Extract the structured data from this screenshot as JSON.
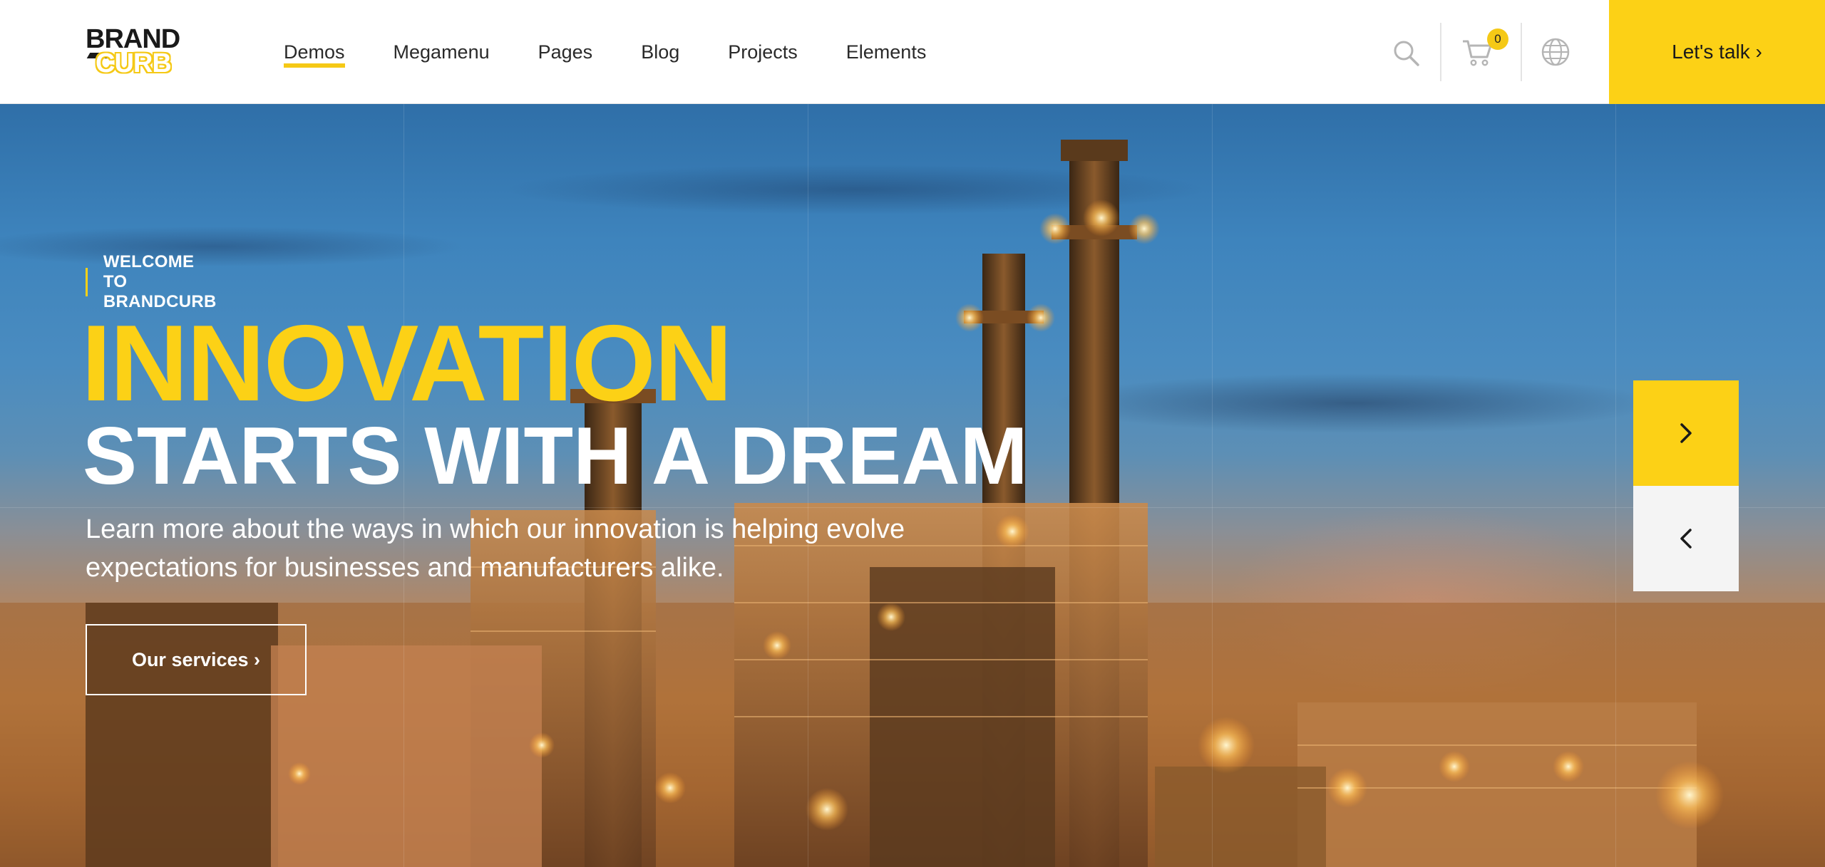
{
  "brand": {
    "line1": "BRAND",
    "line2": "CURB"
  },
  "nav": {
    "items": [
      {
        "label": "Demos",
        "active": true
      },
      {
        "label": "Megamenu",
        "active": false
      },
      {
        "label": "Pages",
        "active": false
      },
      {
        "label": "Blog",
        "active": false
      },
      {
        "label": "Projects",
        "active": false
      },
      {
        "label": "Elements",
        "active": false
      }
    ]
  },
  "header": {
    "cart_count": "0",
    "cta_label": "Let's talk ›",
    "icons": [
      "search-icon",
      "cart-icon",
      "globe-icon"
    ]
  },
  "hero": {
    "eyebrow": "WELCOME TO BRANDCURB",
    "headline_1": "INNOVATION",
    "headline_2": "STARTS WITH A DREAM",
    "lead": "Learn more about the ways in which our innovation is helping evolve expectations for businesses and manufacturers alike.",
    "button_label": "Our services ›"
  },
  "slider": {
    "next_icon": "chevron-right-icon",
    "prev_icon": "chevron-left-icon"
  },
  "colors": {
    "accent": "#fcd116",
    "text_dark": "#2a2a2a",
    "hero_text": "#ffffff"
  }
}
